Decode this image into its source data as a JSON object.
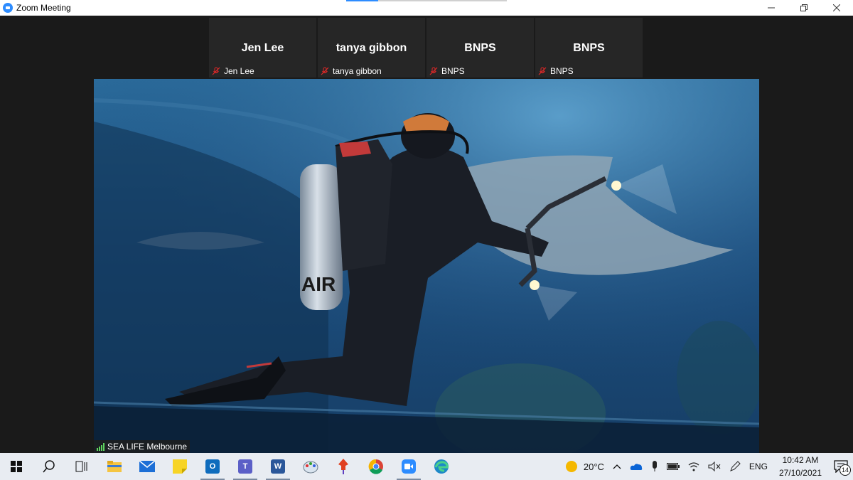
{
  "window": {
    "title": "Zoom Meeting",
    "load_progress": 0.2
  },
  "participants": [
    {
      "display": "Jen Lee",
      "label": "Jen Lee",
      "muted": true
    },
    {
      "display": "tanya gibbon",
      "label": "tanya gibbon",
      "muted": true
    },
    {
      "display": "BNPS",
      "label": "BNPS",
      "muted": true
    },
    {
      "display": "BNPS",
      "label": "BNPS",
      "muted": true
    }
  ],
  "active_speaker": {
    "name": "SEA LIFE Melbourne",
    "tank_label": "AIR"
  },
  "taskbar": {
    "apps": [
      {
        "icon": "start-icon"
      },
      {
        "icon": "search-icon"
      },
      {
        "icon": "task-view-icon"
      },
      {
        "icon": "file-explorer-icon"
      },
      {
        "icon": "mail-icon"
      },
      {
        "icon": "sticky-notes-icon"
      },
      {
        "icon": "outlook-icon"
      },
      {
        "icon": "teams-icon"
      },
      {
        "icon": "word-icon"
      },
      {
        "icon": "paint-icon"
      },
      {
        "icon": "pin-app-icon"
      },
      {
        "icon": "chrome-icon"
      },
      {
        "icon": "zoom-icon"
      },
      {
        "icon": "edge-icon"
      }
    ],
    "weather": "20°C",
    "language": "ENG",
    "time": "10:42 AM",
    "date": "27/10/2021",
    "notification_count": "14"
  },
  "colors": {
    "zoom_blue": "#2d8cff",
    "mic_muted_red": "#e02828",
    "taskbar_bg": "#e8ecf2"
  }
}
